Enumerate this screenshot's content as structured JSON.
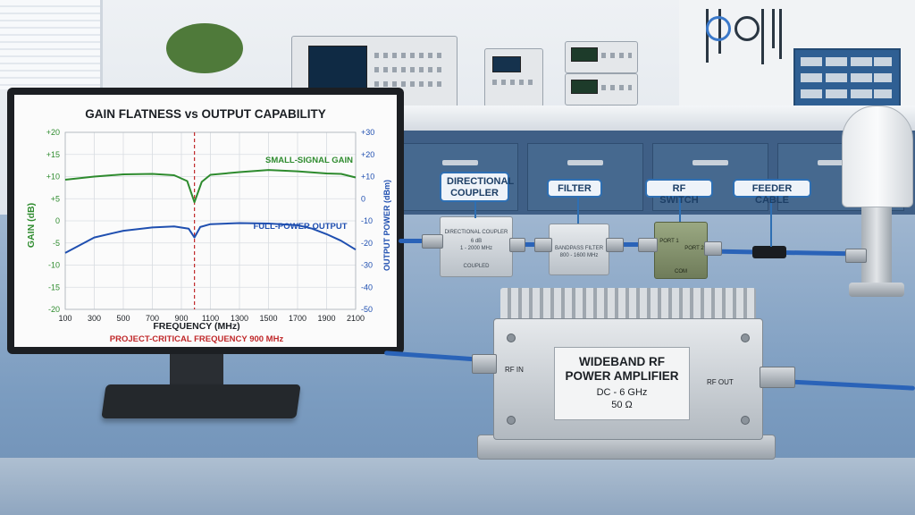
{
  "chart_data": {
    "type": "line",
    "title": "GAIN FLATNESS vs OUTPUT CAPABILITY",
    "xlabel": "FREQUENCY (MHz)",
    "ylabel": "GAIN (dB)",
    "y2label": "OUTPUT POWER (dBm)",
    "xlim": [
      100,
      2100
    ],
    "ylim": [
      -20,
      20
    ],
    "y2lim": [
      -50,
      30
    ],
    "x_ticks": [
      "100",
      "300",
      "500",
      "700",
      "900",
      "1100",
      "1300",
      "1500",
      "1700",
      "1900",
      "2100"
    ],
    "y_ticks": [
      "+20",
      "+15",
      "+10",
      "+5",
      "0",
      "-5",
      "-10",
      "-15",
      "-20"
    ],
    "y2_ticks": [
      "+30",
      "+20",
      "+10",
      "0",
      "-10",
      "-20",
      "-30",
      "-40",
      "-50"
    ],
    "grid": true,
    "marker_line": {
      "x": 990,
      "label": "PROJECT-CRITICAL FREQUENCY 900 MHz"
    },
    "series": [
      {
        "name": "SMALL-SIGNAL GAIN",
        "axis": "left",
        "color": "#2e8b2e",
        "x": [
          100,
          300,
          500,
          700,
          850,
          940,
          990,
          1040,
          1100,
          1300,
          1500,
          1700,
          1900,
          2000,
          2100
        ],
        "y": [
          9.3,
          10.0,
          10.5,
          10.6,
          10.3,
          9.0,
          4.2,
          8.8,
          10.4,
          11.0,
          11.5,
          11.2,
          10.7,
          10.6,
          9.8
        ]
      },
      {
        "name": "FULL-POWER OUTPUT",
        "axis": "right",
        "color": "#1f4fb0",
        "x": [
          100,
          300,
          500,
          700,
          850,
          950,
          990,
          1030,
          1100,
          1300,
          1500,
          1700,
          1800,
          1900,
          2000,
          2100
        ],
        "y": [
          -24.5,
          -17.5,
          -14.5,
          -13.0,
          -12.5,
          -13.5,
          -17.5,
          -12.8,
          -11.5,
          -11.0,
          -11.2,
          -12.0,
          -13.5,
          -16.0,
          -19.0,
          -23.0
        ]
      }
    ]
  },
  "labels": {
    "directional_coupler": "DIRECTIONAL COUPLER",
    "filter": "FILTER",
    "rf_switch": "RF SWITCH",
    "feeder_cable": "FEEDER CABLE"
  },
  "components": {
    "coupler_text": [
      "DIRECTIONAL COUPLER",
      "6 dB",
      "1 - 2000 MHz",
      "COUPLED"
    ],
    "filter_text": [
      "BANDPASS FILTER",
      "800 - 1600 MHz"
    ],
    "switch_text": [
      "PORT 1",
      "PORT 2",
      "COM"
    ]
  },
  "amplifier": {
    "title_line1": "WIDEBAND RF",
    "title_line2": "POWER AMPLIFIER",
    "range": "DC - 6 GHz",
    "impedance": "50 Ω",
    "rf_in": "RF IN",
    "rf_out": "RF OUT"
  },
  "colors": {
    "gain": "#2e8b2e",
    "output": "#1f4fb0",
    "marker": "#c0282a",
    "accent": "#2e6fb3"
  }
}
